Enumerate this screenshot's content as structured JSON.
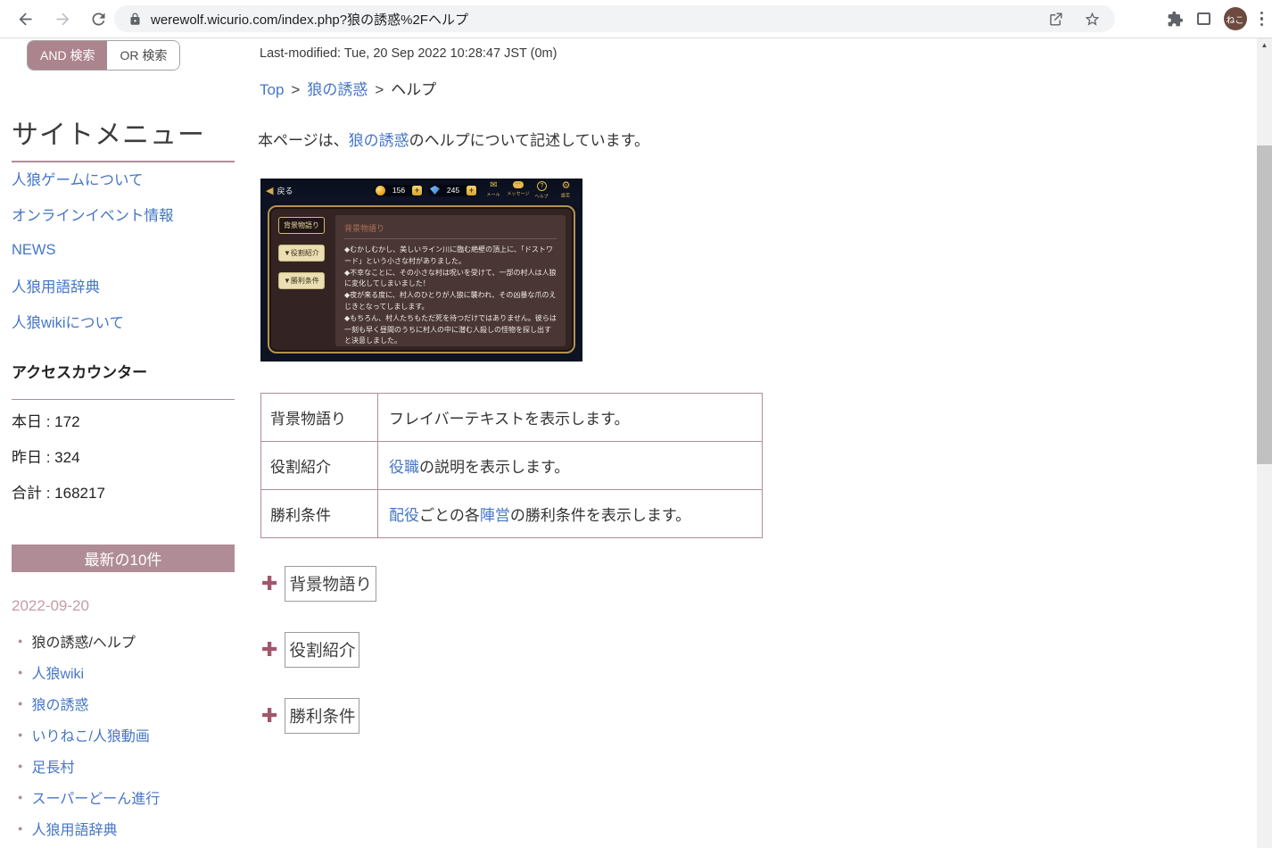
{
  "browser": {
    "url": "werewolf.wicurio.com/index.php?狼の誘惑%2Fヘルプ",
    "profile_initials": "ねこ"
  },
  "sidebar": {
    "search_tabs": {
      "and_label": "AND 検索",
      "or_label": "OR 検索"
    },
    "menu_title": "サイトメニュー",
    "menu_items": [
      "人狼ゲームについて",
      "オンラインイベント情報",
      "NEWS",
      "人狼用語辞典",
      "人狼wikiについて"
    ],
    "counter_title": "アクセスカウンター",
    "counter_lines": [
      "本日 : 172",
      "昨日 : 324",
      "合計 : 168217"
    ],
    "recent_banner": "最新の10件",
    "recent_date": "2022-09-20",
    "recent_items": [
      {
        "label": "狼の誘惑/ヘルプ",
        "link": false
      },
      {
        "label": "人狼wiki",
        "link": true
      },
      {
        "label": "狼の誘惑",
        "link": true
      },
      {
        "label": "いりねこ/人狼動画",
        "link": true
      },
      {
        "label": "足長村",
        "link": true
      },
      {
        "label": "スーパーどーん進行",
        "link": true
      },
      {
        "label": "人狼用語辞典",
        "link": true
      }
    ]
  },
  "main": {
    "last_modified": "Last-modified: Tue, 20 Sep 2022 10:28:47 JST (0m)",
    "breadcrumb": {
      "top": "Top",
      "sep": ">",
      "middle": "狼の誘惑",
      "current": "ヘルプ"
    },
    "intro": {
      "pre": "本ページは、",
      "link": "狼の誘惑",
      "post": "のヘルプについて記述しています。"
    },
    "screenshot": {
      "back_arrow": "◀",
      "back_label": "戻る",
      "coin_count": "156",
      "gem_count": "245",
      "plus_label": "+",
      "nav_icons": [
        {
          "glyph": "mail",
          "label": "メール"
        },
        {
          "glyph": "message",
          "label": "メッセージ"
        },
        {
          "glyph": "help",
          "label": "ヘルプ"
        },
        {
          "glyph": "gear",
          "label": "設定"
        }
      ],
      "side_buttons": [
        {
          "label": "背景物語り",
          "active": true
        },
        {
          "label": "▼役割紹介",
          "active": false
        },
        {
          "label": "▼勝利条件",
          "active": false
        }
      ],
      "panel_title": "背景物語り",
      "story": [
        "◆むかしむかし、美しいライン川に臨む絶壁の頂上に、「ドストワード」という小さな村がありました。",
        "◆不幸なことに、その小さな村は呪いを受けて、一部の村人は人狼に変化してしまいました！",
        "◆夜が来る度に、村人のひとりが人狼に襲われ、その凶暴な爪のえじきとなってしまします。",
        "◆もちろん、村人たちもただ死を待つだけではありません。彼らは一刻も早く昼間のうちに村人の中に潜む人殺しの怪物を探し出すと決意しました。"
      ]
    },
    "table": {
      "rows": [
        {
          "term": "背景物語り",
          "desc": [
            [
              "フレイバーテキストを表示します。",
              false
            ]
          ]
        },
        {
          "term": "役割紹介",
          "desc": [
            [
              "役職",
              true
            ],
            [
              "の説明を表示します。",
              false
            ]
          ]
        },
        {
          "term": "勝利条件",
          "desc": [
            [
              "配役",
              true
            ],
            [
              "ごとの各",
              false
            ],
            [
              "陣営",
              true
            ],
            [
              "の勝利条件を表示します。",
              false
            ]
          ]
        }
      ]
    },
    "expanders": [
      "背景物語り",
      "役割紹介",
      "勝利条件"
    ],
    "plus_glyph": "✚"
  },
  "scrollbar_up_glyph": "▲",
  "colors": {
    "accent_mauve": "#b08d96",
    "link_blue": "#4576c6",
    "plus_red": "#a2566b",
    "avatar_brown": "#6d4a3f",
    "game_gold": "#d9b878",
    "game_panel_bg": "#332423",
    "game_content_bg": "#4a3735"
  }
}
